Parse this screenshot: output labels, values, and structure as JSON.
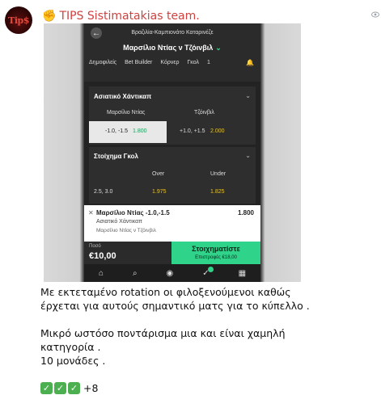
{
  "channel": {
    "avatar_text": "Tip$",
    "name": "TIPS Sistimatakias team.",
    "emoji": "✊"
  },
  "bet_screenshot": {
    "league": "Βραζιλία-Καμπιονάτο Καταρινέζε",
    "match": "Μαρσίλιο Ντίας ν Τζόινβιλ",
    "tabs": [
      "Δημοφιλείς",
      "Bet Builder",
      "Κόρνερ",
      "Γκολ",
      "1"
    ],
    "asian_handicap": {
      "title": "Ασιατικό Χάντικαπ",
      "home": "Μαρσίλιο Ντίας",
      "away": "Τζόινβιλ",
      "home_line": "-1.0, -1.5",
      "home_odd": "1.800",
      "away_line": "+1.0, +1.5",
      "away_odd": "2.000"
    },
    "goals": {
      "title": "Στοίχημα Γκολ",
      "over_label": "Over",
      "under_label": "Under",
      "line": "2.5, 3.0",
      "over_odd": "1.975",
      "under_odd": "1.825"
    },
    "slip": {
      "selection": "Μαρσίλιο Ντίας -1.0,-1.5",
      "market": "Ασιατικό Χάντικαπ",
      "event": "Μαρσίλιο Ντίας ν Τζόινβιλ",
      "odd": "1.800"
    },
    "stake": {
      "label": "Ποσό",
      "value": "€10,00"
    },
    "place_bet": {
      "label": "Στοιχηματίστε",
      "returns": "Επιστροφές €18,00"
    },
    "nav_badge": "1"
  },
  "message": {
    "line1": "Με εκτεταμένο rotation οι φιλοξενούμενοι καθώς",
    "line2": "έρχεται για αυτούς σημαντικό ματς για το κύπελλο .",
    "line3": "Μικρό ωστόσο ποντάρισμα μια και είναι χαμηλή",
    "line4": "κατηγορία .",
    "line5": "10 μονάδες .",
    "reactions_extra": "+8"
  },
  "colors": {
    "channel_name": "#d0413f",
    "accent_green": "#2fd38a",
    "odd_yellow": "#e6c229"
  }
}
